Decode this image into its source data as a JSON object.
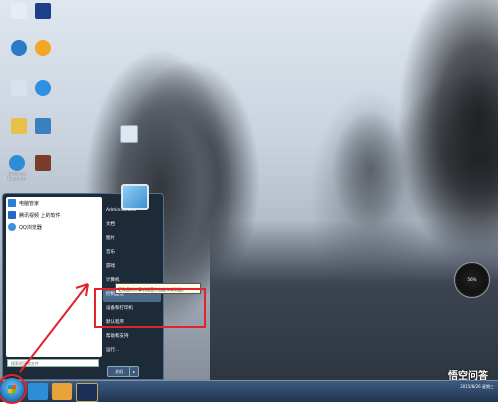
{
  "desktop": {
    "icons": [
      {
        "label": "",
        "color": "#e6ecf3"
      },
      {
        "label": "",
        "color": "#1b3f8a"
      },
      {
        "label": "",
        "color": "#2a7cc7"
      },
      {
        "label": "",
        "color": "#f5a623"
      },
      {
        "label": "",
        "color": "#d7e2ef"
      },
      {
        "label": "",
        "color": "#2f8fe0"
      },
      {
        "label": "",
        "color": "#e8c04a"
      },
      {
        "label": "",
        "color": "#3b7fbf"
      },
      {
        "label": "Internet Explorer",
        "color": "#2d8ed6"
      },
      {
        "label": "",
        "color": "#7a3b2a"
      }
    ]
  },
  "start_menu": {
    "pinned": [
      {
        "label": "电脑管家",
        "color": "#2a7dd6"
      },
      {
        "label": "腾讯视频 上的软件",
        "color": "#2b66c9"
      },
      {
        "label": "QQ浏览器",
        "color": "#3d8fe2"
      }
    ],
    "all_programs": "所有程序",
    "search_placeholder": "搜索程序和文件",
    "user": "Administrator",
    "right_items": [
      "文档",
      "图片",
      "音乐",
      "游戏",
      "计算机",
      "控制面板",
      "设备和打印机",
      "默认程序",
      "帮助和支持",
      "运行..."
    ],
    "highlighted_item": "控制面板",
    "shutdown": "关机",
    "tooltip": "更改您的计算机设置并自定义其功能。"
  },
  "taskbar": {
    "apps": [
      {
        "name": "ie-icon",
        "color": "#2d8ed6"
      },
      {
        "name": "media-icon",
        "color": "#e8a23a"
      },
      {
        "name": "lol-icon",
        "color": "#1a2f55"
      }
    ],
    "date": "2015/8/26 星期三"
  },
  "gauge": {
    "value": "56%"
  },
  "watermark": "悟空问答"
}
